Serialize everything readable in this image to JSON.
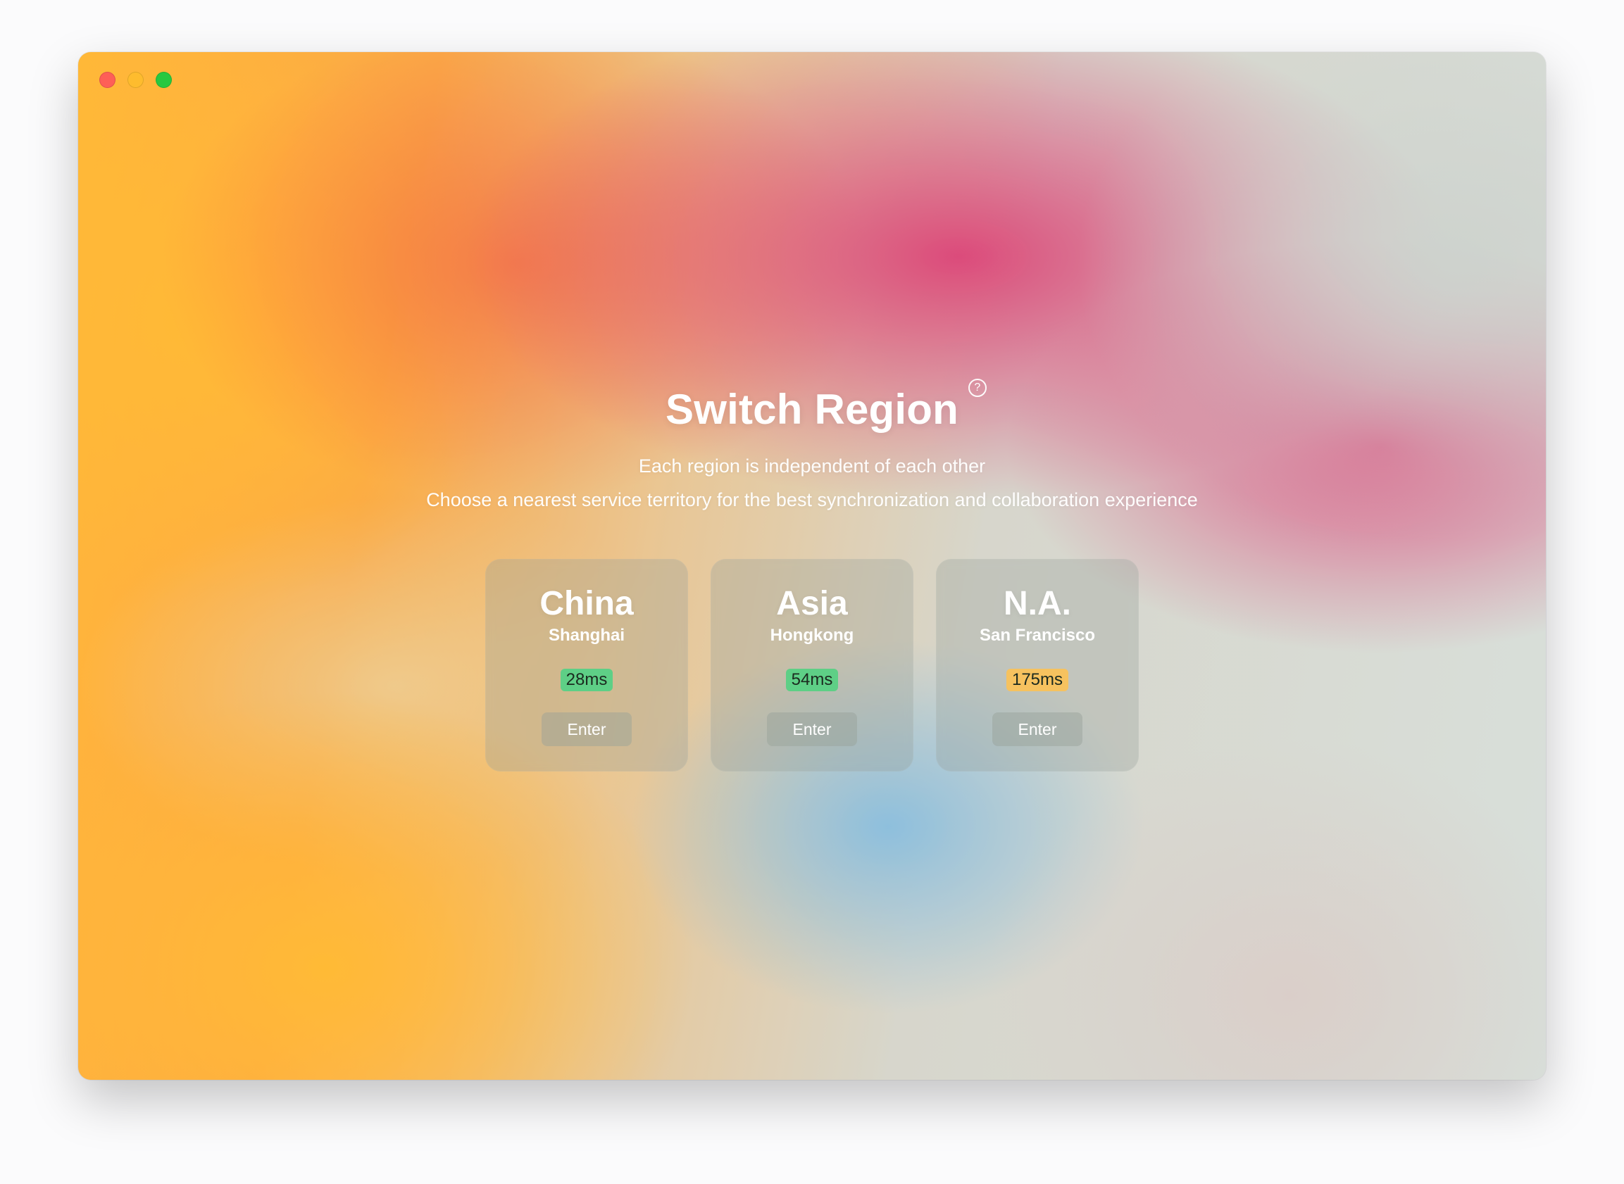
{
  "window": {
    "controls": [
      "close",
      "minimize",
      "zoom"
    ]
  },
  "header": {
    "title": "Switch Region",
    "help_icon": "question-circle-icon",
    "help_glyph": "?",
    "subtitle_line1": "Each region is independent of each other",
    "subtitle_line2": "Choose a nearest service territory for the best synchronization and collaboration experience"
  },
  "regions": [
    {
      "name": "China",
      "city": "Shanghai",
      "latency": "28ms",
      "latency_color": "#5ecf86",
      "button": "Enter"
    },
    {
      "name": "Asia",
      "city": "Hongkong",
      "latency": "54ms",
      "latency_color": "#5ecf86",
      "button": "Enter"
    },
    {
      "name": "N.A.",
      "city": "San Francisco",
      "latency": "175ms",
      "latency_color": "#f6c25f",
      "button": "Enter"
    }
  ],
  "colors": {
    "close": "#fe5f57",
    "minimize": "#febc2e",
    "zoom": "#28c840"
  }
}
